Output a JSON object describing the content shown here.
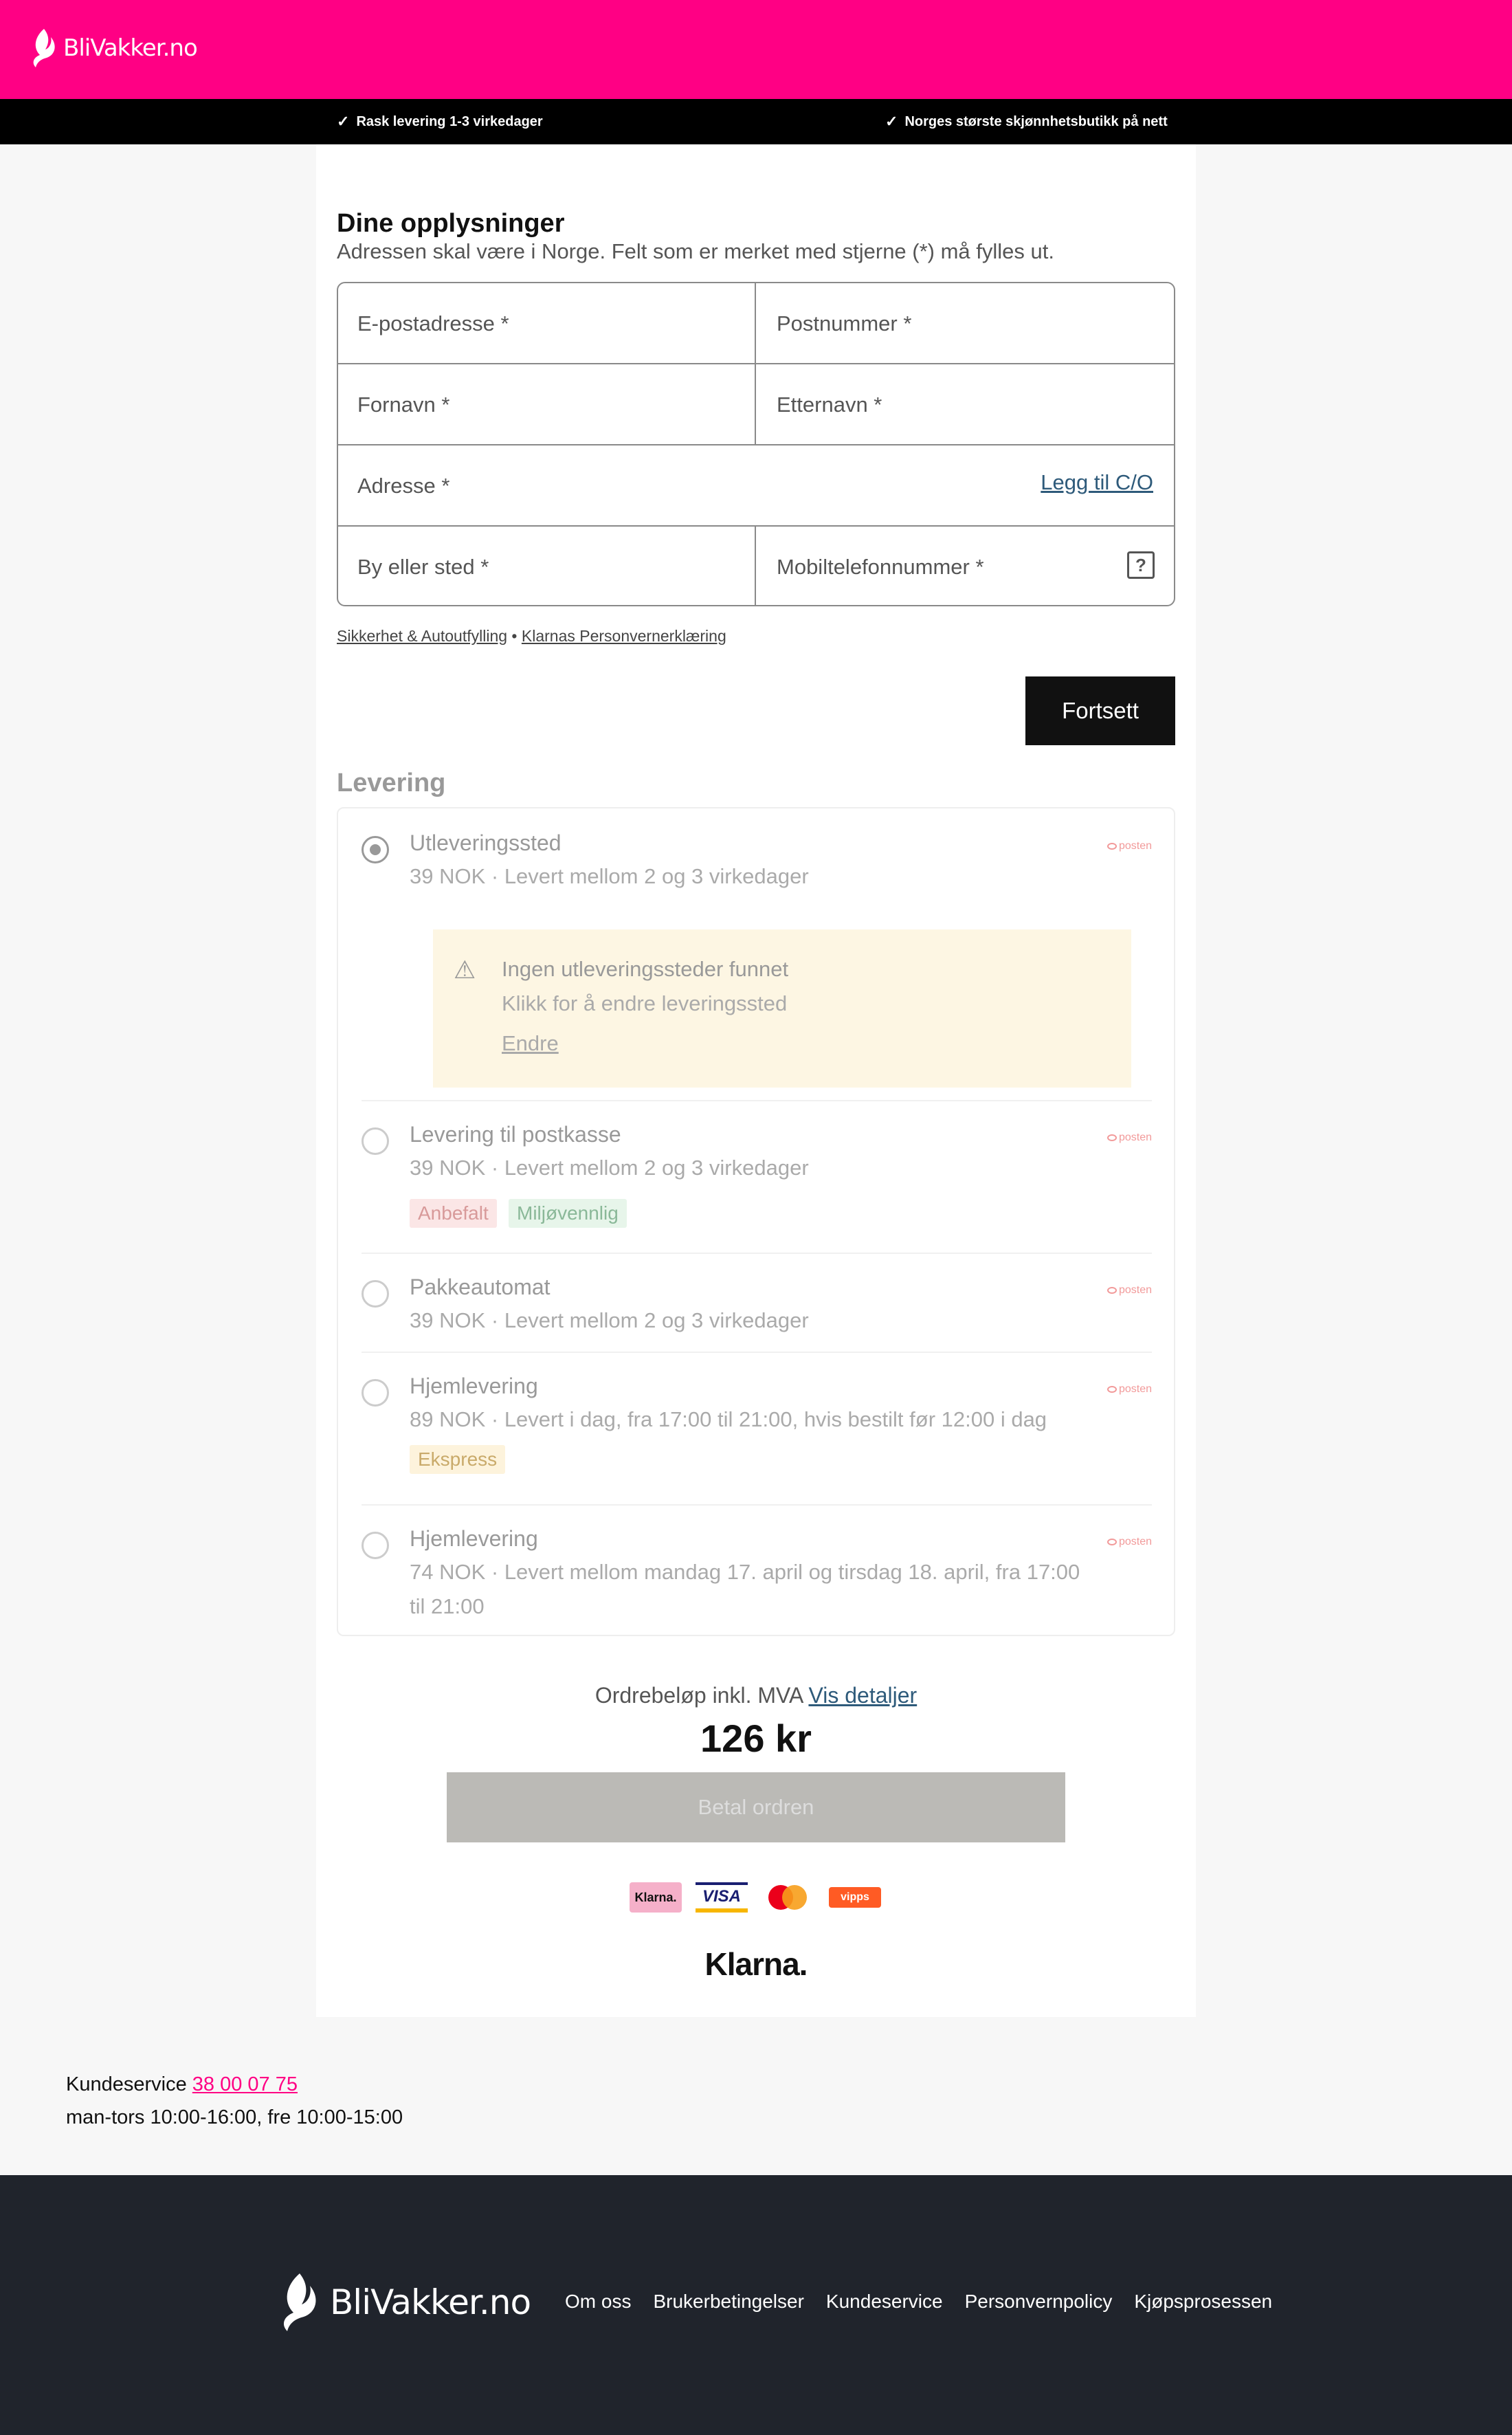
{
  "brand": {
    "name": "BliVakker.no",
    "color": "#ff0084"
  },
  "usp": [
    {
      "icon": "check-icon",
      "text": "Rask levering 1-3 virkedager"
    },
    {
      "icon": "check-icon",
      "text": "Norges største skjønnhetsbutikk på nett"
    }
  ],
  "details": {
    "title": "Dine opplysninger",
    "subtitle": "Adressen skal være i Norge. Felt som er merket med stjerne (*) må fylles ut.",
    "fields": {
      "email": "E-postadresse *",
      "postcode": "Postnummer *",
      "firstname": "Fornavn *",
      "lastname": "Etternavn *",
      "address": "Adresse *",
      "city": "By eller sted *",
      "phone": "Mobiltelefonnummer *"
    },
    "co_link": "Legg til C/O",
    "security_link": "Sikkerhet & Autoutfylling",
    "separator": "•",
    "privacy_link": "Klarnas Personvernerklæring",
    "continue": "Fortsett"
  },
  "delivery": {
    "title": "Levering",
    "carrier": "posten",
    "options": [
      {
        "name": "Utleveringssted",
        "desc": "39 NOK · Levert mellom 2 og 3 virkedager",
        "selected": true
      },
      {
        "name": "Levering til postkasse",
        "desc": "39 NOK · Levert mellom 2 og 3 virkedager",
        "tags": [
          "Anbefalt",
          "Miljøvennlig"
        ]
      },
      {
        "name": "Pakkeautomat",
        "desc": "39 NOK · Levert mellom 2 og 3 virkedager"
      },
      {
        "name": "Hjemlevering",
        "desc": "89 NOK · Levert i dag, fra 17:00 til 21:00, hvis bestilt før 12:00 i dag",
        "tags": [
          "Ekspress"
        ]
      },
      {
        "name": "Hjemlevering",
        "desc": "74 NOK · Levert mellom mandag 17. april og tirsdag 18. april, fra 17:00 til 21:00"
      }
    ],
    "warning": {
      "title": "Ingen utleveringssteder funnet",
      "text": "Klikk for å endre leveringssted",
      "link": "Endre"
    }
  },
  "summary": {
    "label": "Ordrebeløp inkl. MVA",
    "details_link": "Vis detaljer",
    "amount": "126 kr",
    "pay_button": "Betal ordren"
  },
  "payment_methods": {
    "klarna": "Klarna.",
    "visa": "VISA",
    "mastercard": "mastercard-icon",
    "vipps": "vipps"
  },
  "klarna_logo": "Klarna.",
  "customer_service": {
    "label": "Kundeservice",
    "phone": "38 00 07 75",
    "hours": "man-tors 10:00-16:00, fre 10:00-15:00"
  },
  "footer": {
    "links": [
      "Om oss",
      "Brukerbetingelser",
      "Kundeservice",
      "Personvernpolicy",
      "Kjøpsprosessen"
    ]
  }
}
